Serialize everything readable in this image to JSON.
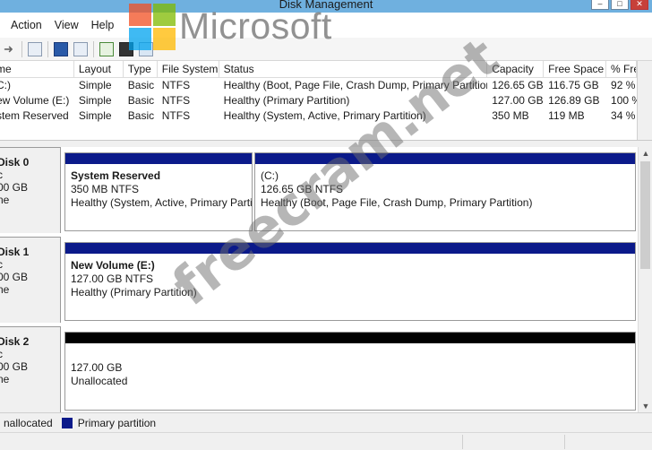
{
  "window": {
    "title": "Disk Management"
  },
  "watermark_brand": "Microsoft",
  "watermark_site": "freecram.net",
  "menu": [
    "Action",
    "View",
    "Help"
  ],
  "volumes": {
    "headers": [
      "me",
      "Layout",
      "Type",
      "File System",
      "Status",
      "Capacity",
      "Free Space",
      "% Free"
    ],
    "rows": [
      [
        "C:)",
        "Simple",
        "Basic",
        "NTFS",
        "Healthy (Boot, Page File, Crash Dump, Primary Partition)",
        "126.65 GB",
        "116.75 GB",
        "92 %"
      ],
      [
        "ew Volume (E:)",
        "Simple",
        "Basic",
        "NTFS",
        "Healthy (Primary Partition)",
        "127.00 GB",
        "126.89 GB",
        "100 %"
      ],
      [
        "stem Reserved",
        "Simple",
        "Basic",
        "NTFS",
        "Healthy (System, Active, Primary Partition)",
        "350 MB",
        "119 MB",
        "34 %"
      ]
    ]
  },
  "disks": [
    {
      "name": "Disk 0",
      "type": "c",
      "size": "00 GB",
      "status": "ne",
      "partitions": [
        {
          "name": "System Reserved",
          "size": "350 MB NTFS",
          "status": "Healthy (System, Active, Primary Partit"
        },
        {
          "name": "(C:)",
          "size": "126.65 GB NTFS",
          "status": "Healthy (Boot, Page File, Crash Dump, Primary Partition)"
        }
      ]
    },
    {
      "name": "Disk 1",
      "type": "c",
      "size": "00 GB",
      "status": "ne",
      "partitions": [
        {
          "name": "New Volume  (E:)",
          "size": "127.00 GB NTFS",
          "status": "Healthy (Primary Partition)"
        }
      ]
    },
    {
      "name": "Disk 2",
      "type": "c",
      "size": "00 GB",
      "status": "ne",
      "partitions": [
        {
          "name": "",
          "size": "127.00 GB",
          "status": "Unallocated"
        }
      ]
    }
  ],
  "legend": {
    "unallocated": "nallocated",
    "primary": "Primary partition"
  },
  "colors": {
    "primary": "#0b1a8a",
    "unallocated": "#000000",
    "titlebar": "#6fb0df"
  }
}
